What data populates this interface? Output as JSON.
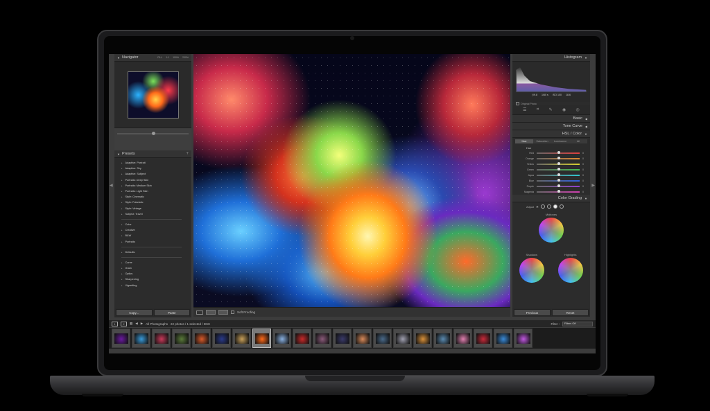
{
  "colors": {
    "accent": "#cccccc",
    "panel": "#2c2c2c"
  },
  "left": {
    "navigator": {
      "title": "Navigator",
      "modes": [
        "FILL",
        "1:1",
        "100%",
        "200%"
      ]
    },
    "presets": {
      "title": "Presets",
      "groups": [
        [
          "Adaptive: Portrait",
          "Adaptive: Sky",
          "Adaptive: Subject",
          "Portraits: Deep Skin",
          "Portraits: Medium Skin",
          "Portraits: Light Skin",
          "Style: Cinematic",
          "Style: Futuristic",
          "Style: Vintage",
          "Subject: Travel"
        ],
        [
          "Color",
          "Creative",
          "B&W",
          "Portraits"
        ],
        [
          "Defaults"
        ],
        [
          "Curve",
          "Grain",
          "Optics",
          "Sharpening",
          "Vignetting"
        ]
      ]
    },
    "copy_label": "Copy...",
    "paste_label": "Paste"
  },
  "toolbar": {
    "soft_proofing": "Soft Proofing"
  },
  "right": {
    "histogram": "Histogram",
    "histo_values": [
      "ƒ/9.8",
      "1/60 s",
      "ISO 100",
      "18.6"
    ],
    "original_photo": "Original Photo",
    "basic": "Basic",
    "tone_curve": "Tone Curve",
    "hsl": "HSL / Color",
    "hsl_tabs": [
      "Hue",
      "Saturation",
      "Luminance",
      "All"
    ],
    "hue_label": "Hue",
    "hue_rows": [
      {
        "name": "Red",
        "value": "0",
        "color": "#e04040"
      },
      {
        "name": "Orange",
        "value": "0",
        "color": "#e08a30"
      },
      {
        "name": "Yellow",
        "value": "0",
        "color": "#d8d030"
      },
      {
        "name": "Green",
        "value": "0",
        "color": "#40c050"
      },
      {
        "name": "Aqua",
        "value": "0",
        "color": "#30c8d0"
      },
      {
        "name": "Blue",
        "value": "0",
        "color": "#3060e0"
      },
      {
        "name": "Purple",
        "value": "0",
        "color": "#9040d0"
      },
      {
        "name": "Magenta",
        "value": "0",
        "color": "#d040b0"
      }
    ],
    "color_grading": "Color Grading",
    "adjust": "Adjust",
    "midtones": "Midtones",
    "shadows": "Shadows",
    "highlights": "Highlights",
    "previous_label": "Previous",
    "reset_label": "Reset"
  },
  "filmbar": {
    "source": "All Photographs",
    "count": "22 photos / 1 selected / DSC",
    "filter": "Filter :",
    "filter_value": "Filters Off"
  },
  "filmstrip": {
    "thumbs": [
      "#6a1aa0",
      "#3a9ad8",
      "#c83a5a",
      "#5a7a3a",
      "#d85a2a",
      "#2a3a8a",
      "#c8a05a",
      "#ff6a1a",
      "#8ab0e0",
      "#c82a2a",
      "#8a5a7a",
      "#3a3a6a",
      "#d88a5a",
      "#4a6a8a",
      "#a0a0b0",
      "#d8903a",
      "#5a8ab0",
      "#e080b0",
      "#c82a3a",
      "#3a8ad8",
      "#c058e0"
    ],
    "selected": 7
  }
}
